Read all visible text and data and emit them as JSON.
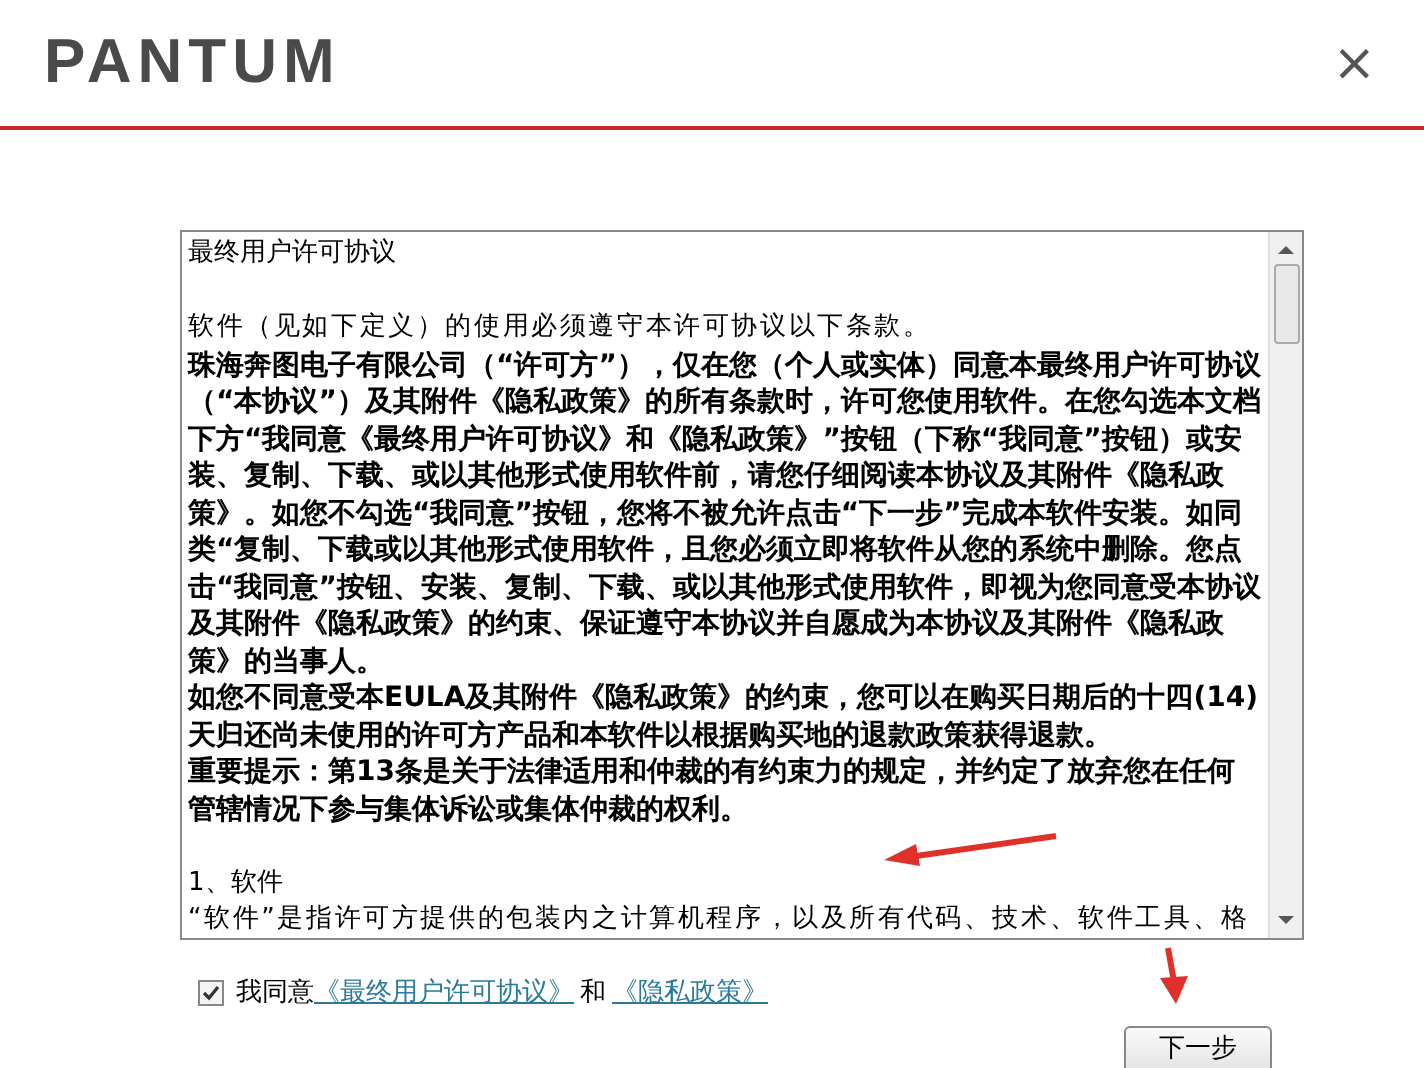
{
  "header": {
    "logo": "PANTUM",
    "close": "×"
  },
  "agreement": {
    "paragraphs": [
      {
        "kind": "title",
        "text": "最终用户许可协议"
      },
      {
        "kind": "plain",
        "text": "软件（见如下定义）的使用必须遵守本许可协议以下条款。"
      },
      {
        "kind": "bold",
        "text": "珠海奔图电子有限公司（“许可方”），仅在您（个人或实体）同意本最终用户许可协议（“本协议”）及其附件《隐私政策》的所有条款时，许可您使用软件。在您勾选本文档下方“我同意《最终用户许可协议》和《隐私政策》”按钮（下称“我同意”按钮）或安装、复制、下载、或以其他形式使用软件前，请您仔细阅读本协议及其附件《隐私政策》。如您不勾选“我同意”按钮，您将不被允许点击“下一步”完成本软件安装。如同类“复制、下载或以其他形式使用软件，且您必须立即将软件从您的系统中删除。您点击“我同意”按钮、安装、复制、下载、或以其他形式使用软件，即视为您同意受本协议及其附件《隐私政策》的约束、保证遵守本协议并自愿成为本协议及其附件《隐私政策》的当事人。"
      },
      {
        "kind": "bold",
        "text": "如您不同意受本EULA及其附件《隐私政策》的约束，您可以在购买日期后的十四(14)天归还尚未使用的许可方产品和本软件以根据购买地的退款政策获得退款。"
      },
      {
        "kind": "bold",
        "text": "重要提示：第13条是关于法律适用和仲裁的有约束力的规定，并约定了放弃您在任何管辖情况下参与集体诉讼或集体仲裁的权利。"
      },
      {
        "kind": "section",
        "text": "1、软件"
      },
      {
        "kind": "plain",
        "text": "“软件”是指许可方提供的包装内之计算机程序，以及所有代码、技术、软件工具、格"
      }
    ]
  },
  "consent": {
    "checked": true,
    "prefix": "我同意",
    "link_1": "《最终用户许可协议》",
    "joiner": "和",
    "link_2": "《隐私政策》"
  },
  "next_button": "下一步"
}
